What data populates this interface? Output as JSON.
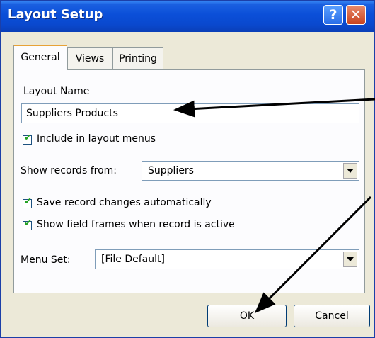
{
  "window": {
    "title": "Layout Setup"
  },
  "titlebar": {
    "help_label": "?",
    "close_label": "✕"
  },
  "tabs": [
    {
      "label": "General",
      "active": true
    },
    {
      "label": "Views",
      "active": false
    },
    {
      "label": "Printing",
      "active": false
    }
  ],
  "general": {
    "layout_name_label": "Layout Name",
    "layout_name_value": "Suppliers Products",
    "include_in_menus_label": "Include in layout menus",
    "include_in_menus_checked": true,
    "show_records_label": "Show records from:",
    "show_records_value": "Suppliers",
    "save_changes_label": "Save record changes automatically",
    "save_changes_checked": true,
    "show_frames_label": "Show field frames when record is active",
    "show_frames_checked": true,
    "menu_set_label": "Menu Set:",
    "menu_set_value": "[File Default]"
  },
  "buttons": {
    "ok": "OK",
    "cancel": "Cancel"
  },
  "colors": {
    "titlebar": "#0b4fd8",
    "dialog_bg": "#ece9d8",
    "active_tab_accent": "#e7a237",
    "checkmark": "#21a121",
    "annotation_arrow": "#000000"
  },
  "icons": {
    "help": "help-icon",
    "close": "close-icon",
    "dropdown": "chevron-down-icon",
    "check": "checkmark-icon"
  }
}
